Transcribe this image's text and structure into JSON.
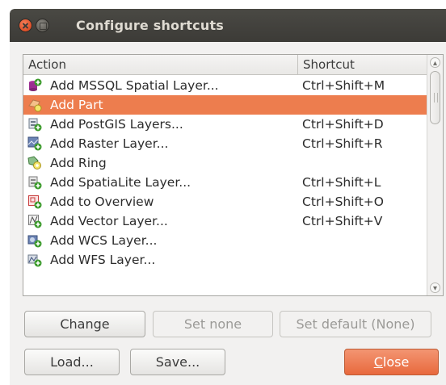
{
  "window": {
    "title": "Configure shortcuts"
  },
  "table": {
    "columns": [
      "Action",
      "Shortcut"
    ],
    "rows": [
      {
        "action": "Add MSSQL Spatial Layer...",
        "shortcut": "Ctrl+Shift+M",
        "icon": "mssql-layer-icon",
        "selected": false
      },
      {
        "action": "Add Part",
        "shortcut": "",
        "icon": "add-part-icon",
        "selected": true
      },
      {
        "action": "Add PostGIS Layers...",
        "shortcut": "Ctrl+Shift+D",
        "icon": "postgis-layer-icon",
        "selected": false
      },
      {
        "action": "Add Raster Layer...",
        "shortcut": "Ctrl+Shift+R",
        "icon": "raster-layer-icon",
        "selected": false
      },
      {
        "action": "Add Ring",
        "shortcut": "",
        "icon": "add-ring-icon",
        "selected": false
      },
      {
        "action": "Add SpatiaLite Layer...",
        "shortcut": "Ctrl+Shift+L",
        "icon": "spatialite-layer-icon",
        "selected": false
      },
      {
        "action": "Add to Overview",
        "shortcut": "Ctrl+Shift+O",
        "icon": "overview-icon",
        "selected": false
      },
      {
        "action": "Add Vector Layer...",
        "shortcut": "Ctrl+Shift+V",
        "icon": "vector-layer-icon",
        "selected": false
      },
      {
        "action": "Add WCS Layer...",
        "shortcut": "",
        "icon": "wcs-layer-icon",
        "selected": false
      },
      {
        "action": "Add WFS Layer...",
        "shortcut": "",
        "icon": "wfs-layer-icon",
        "selected": false
      }
    ]
  },
  "buttons": {
    "change": "Change",
    "set_none": "Set none",
    "set_default": "Set default (None)",
    "load": "Load...",
    "save": "Save...",
    "close_mnemonic": "C",
    "close_rest": "lose"
  },
  "colors": {
    "selection": "#ed7d4e",
    "titlebar": "#3c3b37",
    "close_button": "#e8693d"
  }
}
